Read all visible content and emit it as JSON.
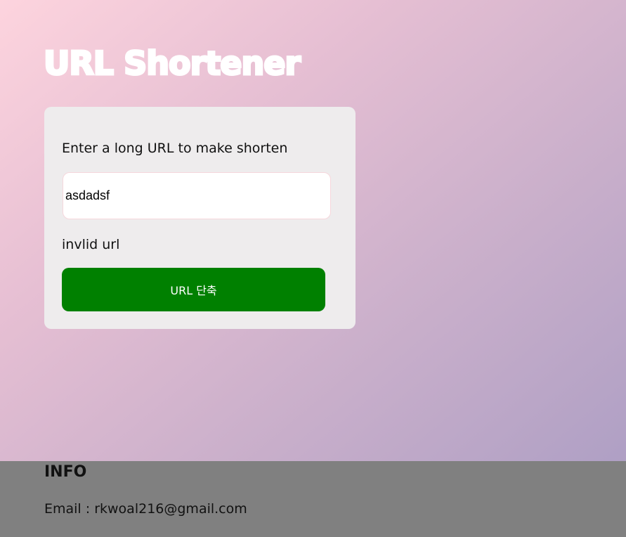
{
  "header": {
    "title": "URL Shortener"
  },
  "form": {
    "label": "Enter a long URL to make shorten",
    "input_value": "asdadsf",
    "error_message": "invlid url",
    "submit_label": "URL 단축"
  },
  "footer": {
    "title": "INFO",
    "email_label": "Email : ",
    "email_value": "rkwoal216@gmail.com"
  }
}
